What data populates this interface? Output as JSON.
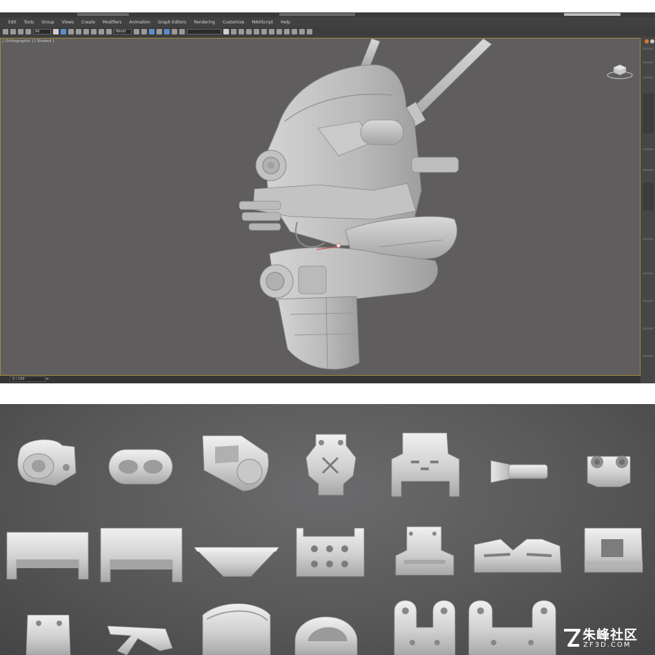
{
  "menu": {
    "items": [
      "Edit",
      "Tools",
      "Group",
      "Views",
      "Create",
      "Modifiers",
      "Animation",
      "Graph Editors",
      "Rendering",
      "Customize",
      "MAXScript",
      "Help"
    ]
  },
  "toolbar": {
    "selection_filter": "All",
    "reference_coord": "World"
  },
  "viewport": {
    "label": "[ Orthographic ] [ Shaded ]",
    "view_cube_icon": "view-cube-icon",
    "model": "mech-head"
  },
  "timeline": {
    "frame": "0 / 100",
    "next_label": ">"
  },
  "render": {
    "parts_icon_names": [
      "pulley-part",
      "link-part",
      "bracket-part",
      "servo-horn-part",
      "servo-bracket-part",
      "screw-part",
      "clamp-part",
      "channel-part",
      "channel-part",
      "funnel-part",
      "plate-part",
      "angle-bracket-part",
      "gripper-part",
      "box-part",
      "plate-part",
      "wishbone-part",
      "tube-clamp-part",
      "ring-clamp-part",
      "u-bracket-part",
      "u-bracket-part"
    ]
  },
  "watermark": {
    "name": "朱峰社区",
    "site": "ZF3D.COM"
  },
  "colors": {
    "viewport_bg": "#5f5d5e",
    "active_border": "#a08c36",
    "select_blue": "#5b8ccd",
    "model_gray": "#bdbdbd"
  }
}
